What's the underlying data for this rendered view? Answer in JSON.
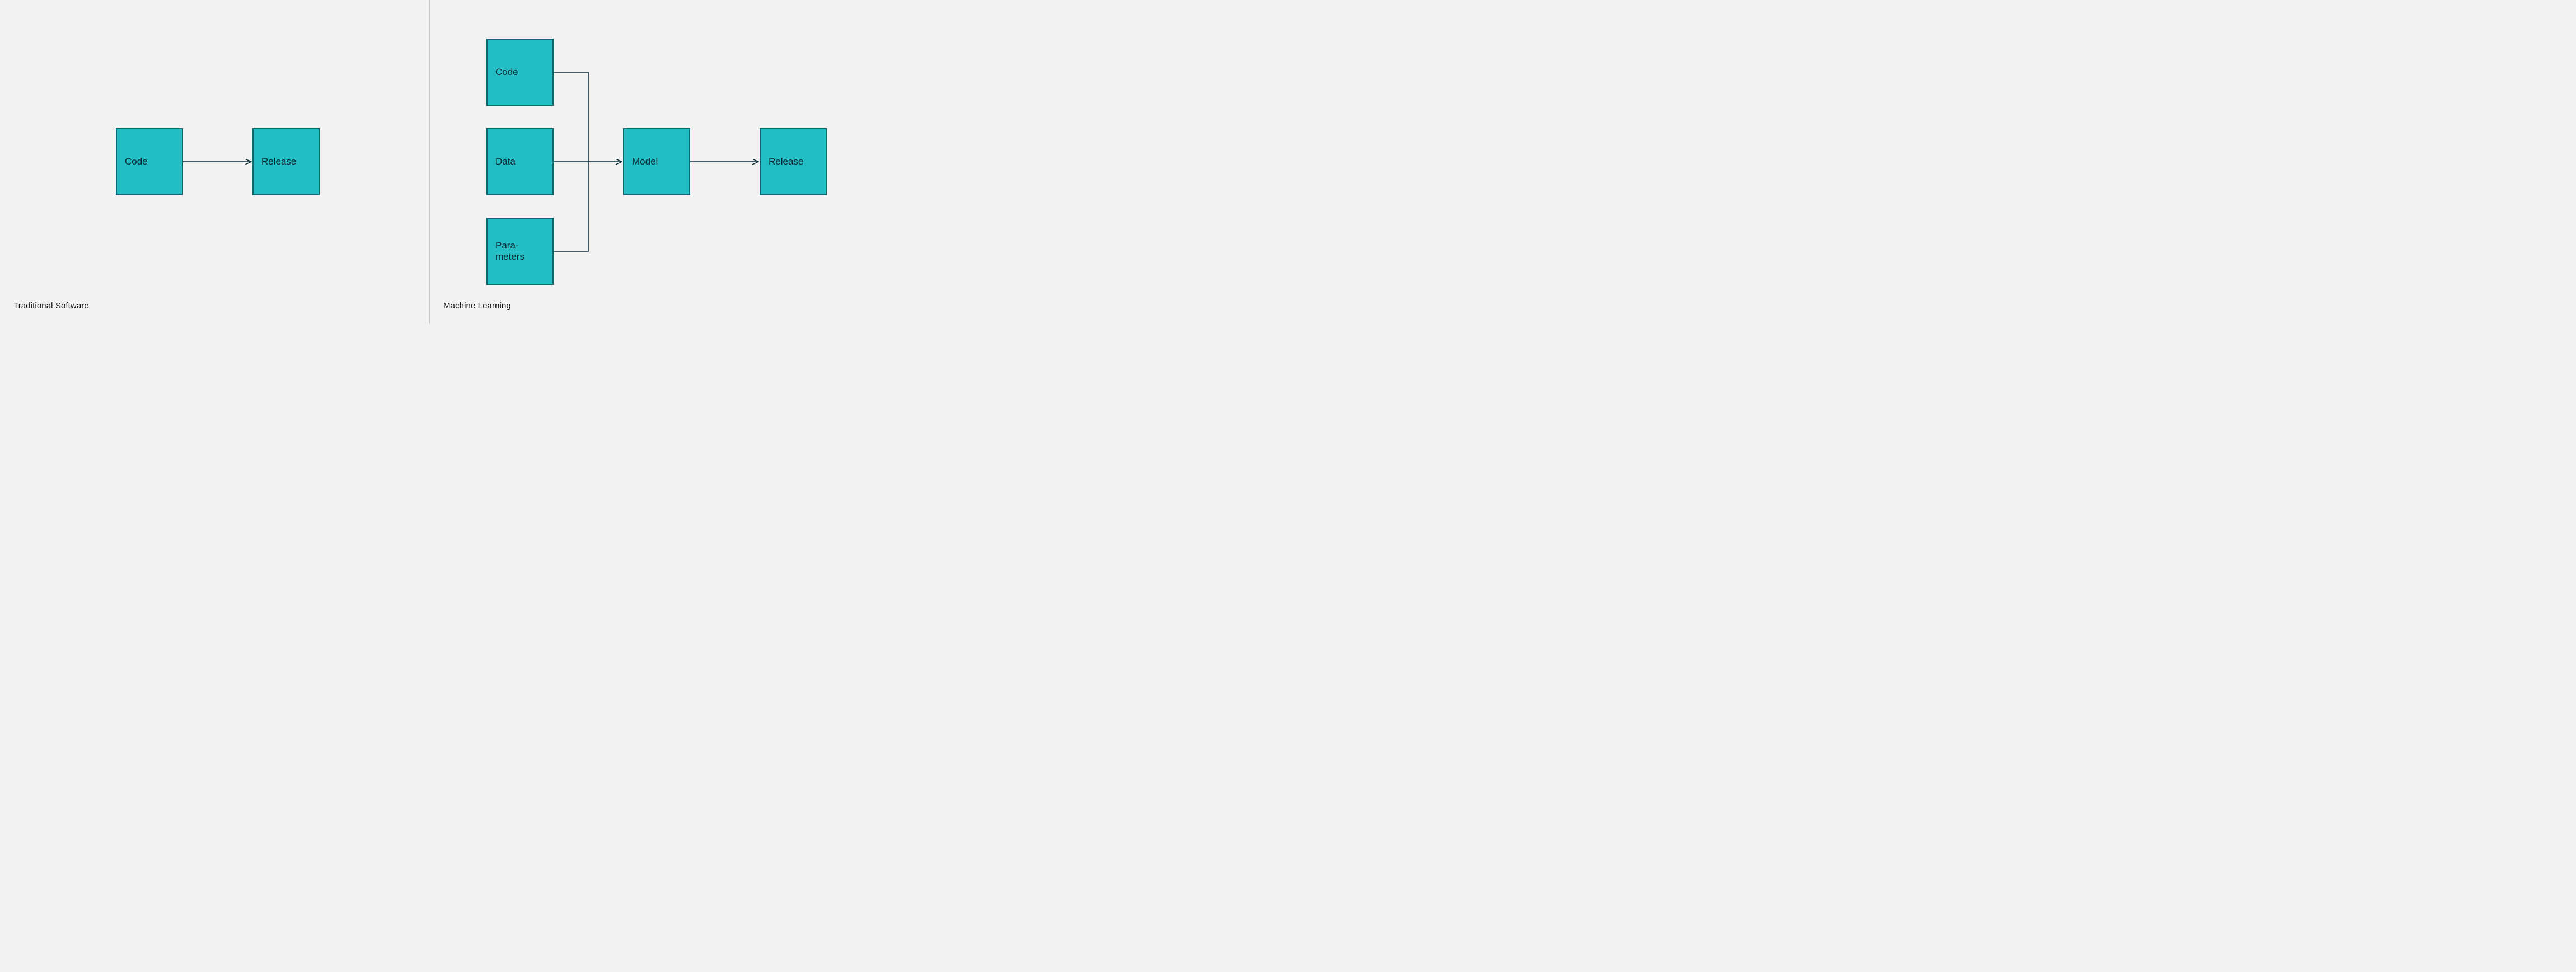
{
  "left": {
    "title": "Traditional Software",
    "boxes": {
      "code": "Code",
      "release": "Release"
    }
  },
  "right": {
    "title": "Machine Learning",
    "boxes": {
      "code": "Code",
      "data": "Data",
      "parameters": "Para-\nmeters",
      "model": "Model",
      "release": "Release"
    }
  },
  "colors": {
    "box_fill": "#24bfc4",
    "box_border": "#0b6a6e",
    "text": "#0b2b36",
    "background": "#f2f2f2",
    "divider": "#c8c8c8"
  }
}
